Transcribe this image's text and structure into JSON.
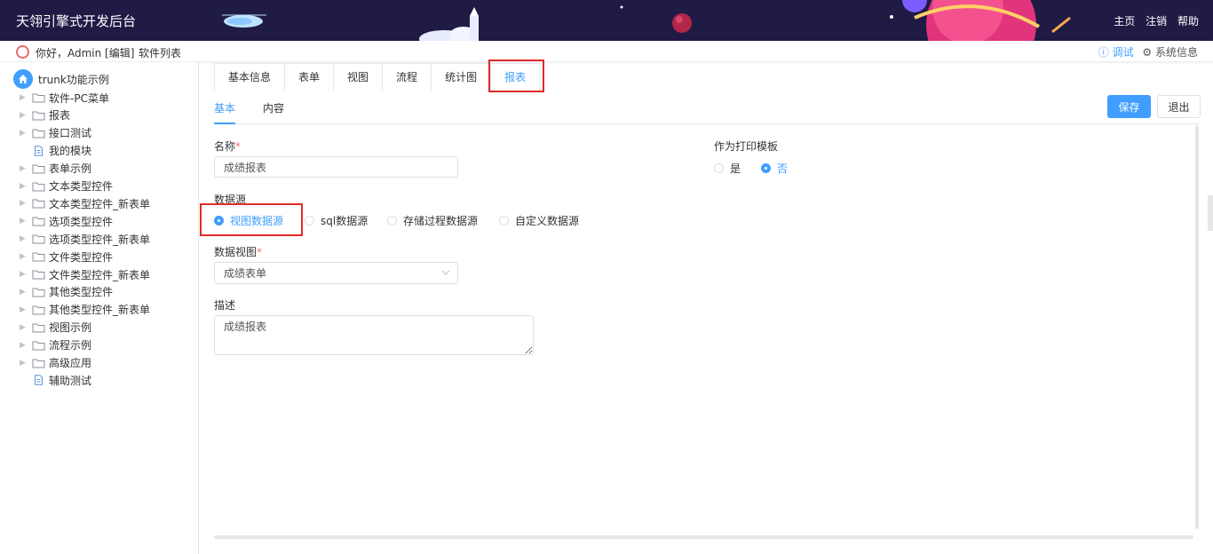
{
  "header": {
    "title": "天翎引擎式开发后台",
    "links": [
      "主页",
      "注销",
      "帮助"
    ]
  },
  "subbar": {
    "greeting": "你好，Admin [编辑]",
    "software_list": "软件列表",
    "debug": "ⓘ 调试",
    "system_info": "⚙ 系统信息"
  },
  "tree": {
    "root": "trunk功能示例",
    "items": [
      {
        "label": "软件-PC菜单",
        "type": "folder"
      },
      {
        "label": "报表",
        "type": "folder"
      },
      {
        "label": "接口测试",
        "type": "folder"
      },
      {
        "label": "我的模块",
        "type": "file"
      },
      {
        "label": "表单示例",
        "type": "folder"
      },
      {
        "label": "文本类型控件",
        "type": "folder"
      },
      {
        "label": "文本类型控件_新表单",
        "type": "folder"
      },
      {
        "label": "选项类型控件",
        "type": "folder"
      },
      {
        "label": "选项类型控件_新表单",
        "type": "folder"
      },
      {
        "label": "文件类型控件",
        "type": "folder"
      },
      {
        "label": "文件类型控件_新表单",
        "type": "folder"
      },
      {
        "label": "其他类型控件",
        "type": "folder"
      },
      {
        "label": "其他类型控件_新表单",
        "type": "folder"
      },
      {
        "label": "视图示例",
        "type": "folder"
      },
      {
        "label": "流程示例",
        "type": "folder"
      },
      {
        "label": "高级应用",
        "type": "folder"
      },
      {
        "label": "辅助测试",
        "type": "file"
      }
    ]
  },
  "tabs": [
    "基本信息",
    "表单",
    "视图",
    "流程",
    "统计图",
    "报表"
  ],
  "active_tab": "报表",
  "subtabs": [
    "基本",
    "内容"
  ],
  "buttons": {
    "save": "保存",
    "exit": "退出"
  },
  "form": {
    "name_label": "名称",
    "name_value": "成绩报表",
    "print_template_label": "作为打印模板",
    "print_options": [
      "是",
      "否"
    ],
    "print_selected": "否",
    "datasource_label": "数据源",
    "datasource_options": [
      "视图数据源",
      "sql数据源",
      "存储过程数据源",
      "自定义数据源"
    ],
    "datasource_selected": "视图数据源",
    "dataview_label": "数据视图",
    "dataview_value": "成绩表单",
    "desc_label": "描述",
    "desc_value": "成绩报表"
  },
  "colors": {
    "accent": "#409eff",
    "header_bg": "#1f1b45",
    "highlight": "#e02b27"
  }
}
